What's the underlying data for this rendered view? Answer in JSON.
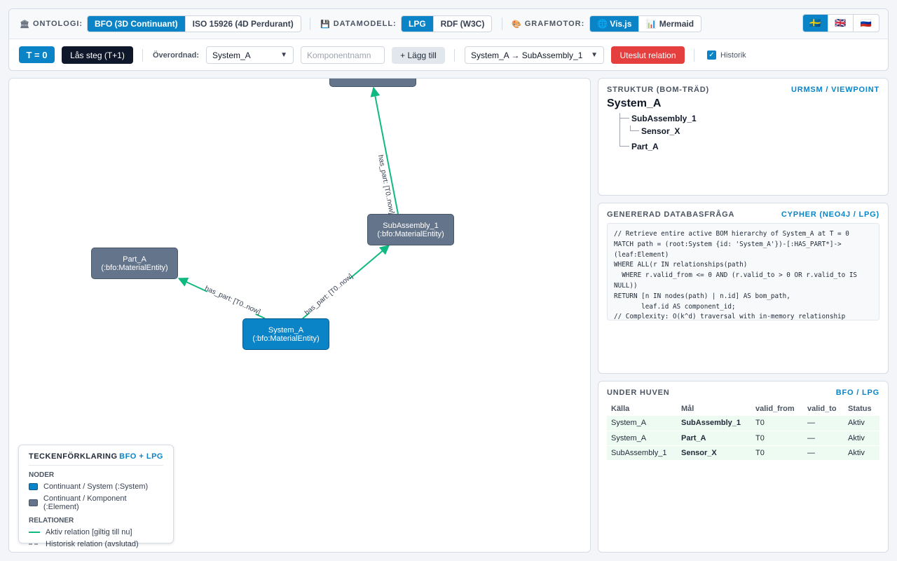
{
  "toolbar": {
    "ontology": {
      "label": "ONTOLOGI:",
      "icon": "institution-icon",
      "options": [
        "BFO (3D Continuant)",
        "ISO 15926 (4D Perdurant)"
      ],
      "selected": "BFO (3D Continuant)"
    },
    "datamodel": {
      "label": "DATAMODELL:",
      "icon": "floppy-disk-icon",
      "options": [
        "LPG",
        "RDF (W3C)"
      ],
      "selected": "LPG"
    },
    "engine": {
      "label": "GRAFMOTOR:",
      "icon": "palette-icon",
      "options": [
        "🌐 Vis.js",
        "📊 Mermaid"
      ],
      "selected": "🌐 Vis.js"
    },
    "languages": [
      {
        "flag": "🇸🇪",
        "code": "sv"
      },
      {
        "flag": "🇬🇧",
        "code": "en"
      },
      {
        "flag": "🇷🇺",
        "code": "ru"
      }
    ],
    "time_badge": "T = 0",
    "lock_step_button": "Lås steg (T+1)",
    "parent_label": "Överordnad:",
    "parent_value": "System_A",
    "component_placeholder": "Komponentnamn",
    "add_button": "+ Lägg till",
    "relation_value": "System_A → SubAssembly_1",
    "exclude_button": "Uteslut relation",
    "history_label": "Historik"
  },
  "graph": {
    "nodes": [
      {
        "id": "top",
        "line1": "",
        "line2": ""
      },
      {
        "id": "subassembly",
        "line1": "SubAssembly_1",
        "line2": "(:bfo:MaterialEntity)"
      },
      {
        "id": "part",
        "line1": "Part_A",
        "line2": "(:bfo:MaterialEntity)"
      },
      {
        "id": "system",
        "line1": "System_A",
        "line2": "(:bfo:MaterialEntity)"
      }
    ],
    "edges": [
      {
        "label": "has_part: [T0..now]"
      },
      {
        "label": "has_part: [T0..now]"
      },
      {
        "label": "has_part: [T0..now]"
      }
    ],
    "colors": {
      "continuant_system": "#0a84c6",
      "continuant_component": "#64748b",
      "active_relation": "#10b981",
      "historic_relation": "#9ca3af"
    }
  },
  "legend": {
    "title": "TECKENFÖRKLARING",
    "accent": "BFO + LPG",
    "nodes_label": "NODER",
    "node_items": [
      "Continuant / System (:System)",
      "Continuant / Komponent (:Element)"
    ],
    "relations_label": "RELATIONER",
    "relation_items": [
      "Aktiv relation [giltig till nu]",
      "Historisk relation (avslutad)"
    ]
  },
  "structure": {
    "title": "STRUKTUR (BOM-TRÄD)",
    "accent": "URMSM / VIEWPOINT",
    "root": "System_A",
    "items": [
      "SubAssembly_1",
      "Sensor_X",
      "Part_A"
    ]
  },
  "query": {
    "title": "GENERERAD DATABASFRÅGA",
    "accent": "CYPHER (NEO4J / LPG)",
    "code": "// Retrieve entire active BOM hierarchy of System_A at T = 0\nMATCH path = (root:System {id: 'System_A'})-[:HAS_PART*]->\n(leaf:Element)\nWHERE ALL(r IN relationships(path)\n  WHERE r.valid_from <= 0 AND (r.valid_to > 0 OR r.valid_to IS\nNULL))\nRETURN [n IN nodes(path) | n.id] AS bom_path,\n       leaf.id AS component_id;\n// Complexity: O(k^d) traversal with in-memory relationship"
  },
  "under_hood": {
    "title": "UNDER HUVEN",
    "accent": "BFO / LPG",
    "columns": [
      "Källa",
      "Mål",
      "valid_from",
      "valid_to",
      "Status"
    ],
    "rows": [
      [
        "System_A",
        "SubAssembly_1",
        "T0",
        "—",
        "Aktiv"
      ],
      [
        "System_A",
        "Part_A",
        "T0",
        "—",
        "Aktiv"
      ],
      [
        "SubAssembly_1",
        "Sensor_X",
        "T0",
        "—",
        "Aktiv"
      ]
    ]
  }
}
